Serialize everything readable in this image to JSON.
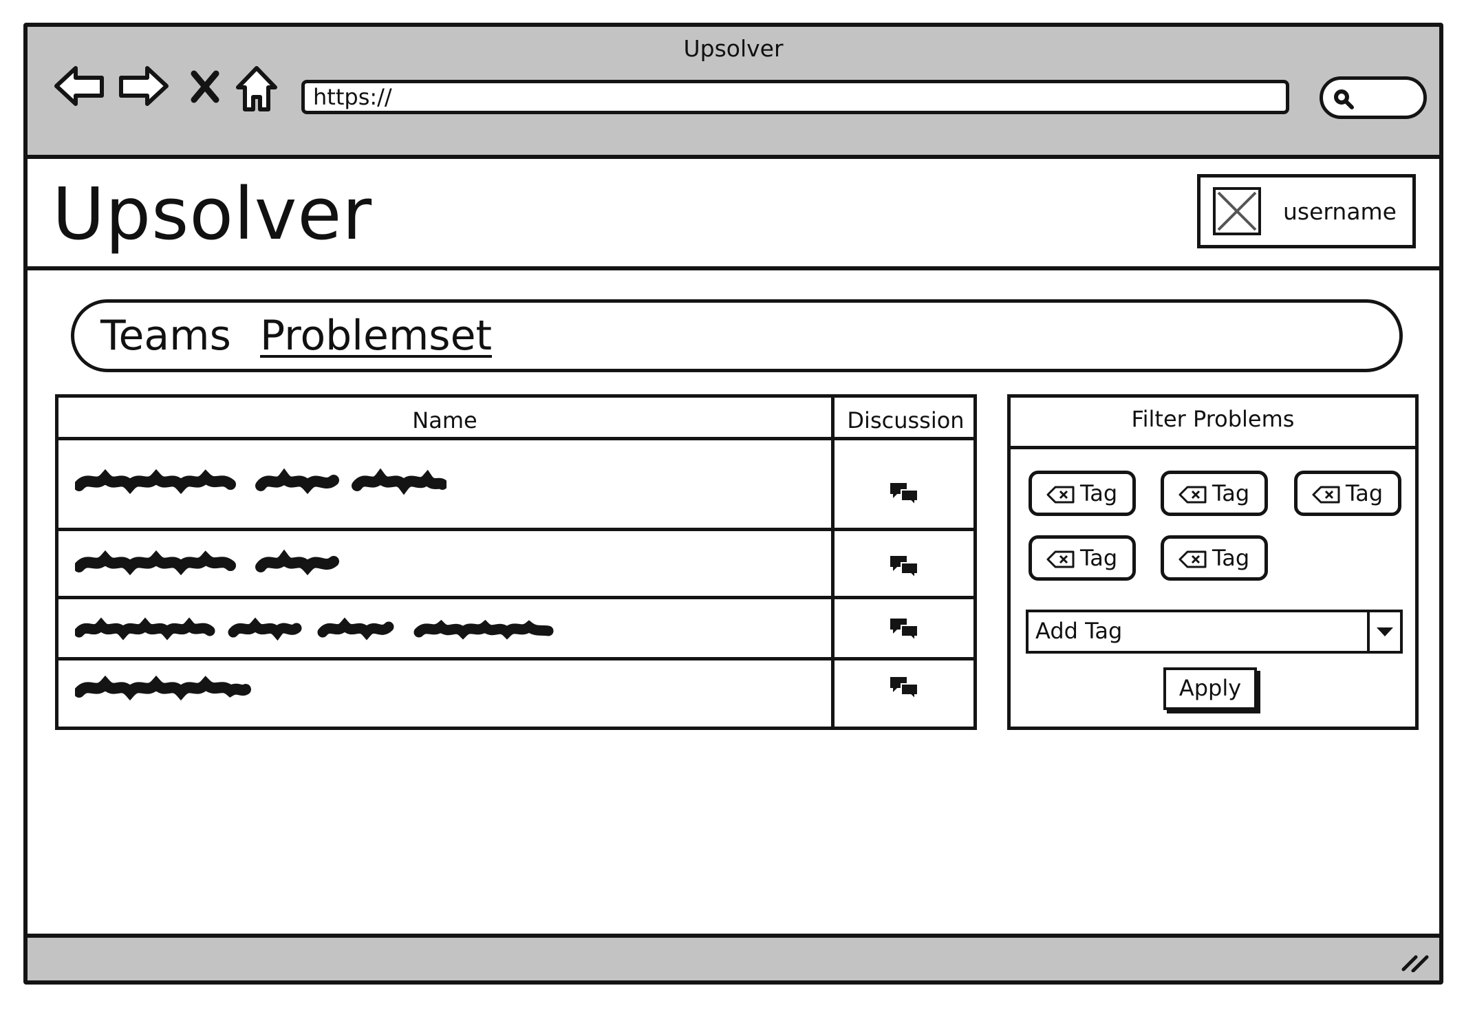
{
  "window": {
    "title": "Upsolver",
    "url": "https://",
    "icons": [
      "back-arrow-icon",
      "forward-arrow-icon",
      "close-x-icon",
      "home-icon",
      "search-icon",
      "resize-grip-icon"
    ]
  },
  "header": {
    "app_title": "Upsolver",
    "username": "username",
    "avatar_icon": "image-placeholder-icon"
  },
  "tabs": [
    {
      "label": "Teams",
      "active": false
    },
    {
      "label": "Problemset",
      "active": true
    }
  ],
  "problems_table": {
    "columns": [
      "Name",
      "Discussion"
    ],
    "rows": [
      {
        "name_redacted": true,
        "discussion_icon": "discussion-icon"
      },
      {
        "name_redacted": true,
        "discussion_icon": "discussion-icon"
      },
      {
        "name_redacted": true,
        "discussion_icon": "discussion-icon"
      },
      {
        "name_redacted": true,
        "discussion_icon": "discussion-icon"
      }
    ]
  },
  "filter": {
    "title": "Filter Problems",
    "tags": [
      "Tag",
      "Tag",
      "Tag",
      "Tag",
      "Tag"
    ],
    "tag_remove_icon": "backspace-x-icon",
    "add_tag_placeholder": "Add Tag",
    "apply_label": "Apply"
  },
  "colors": {
    "chrome_gray": "#c3c3c3",
    "ink": "#141414",
    "background": "#ffffff"
  }
}
